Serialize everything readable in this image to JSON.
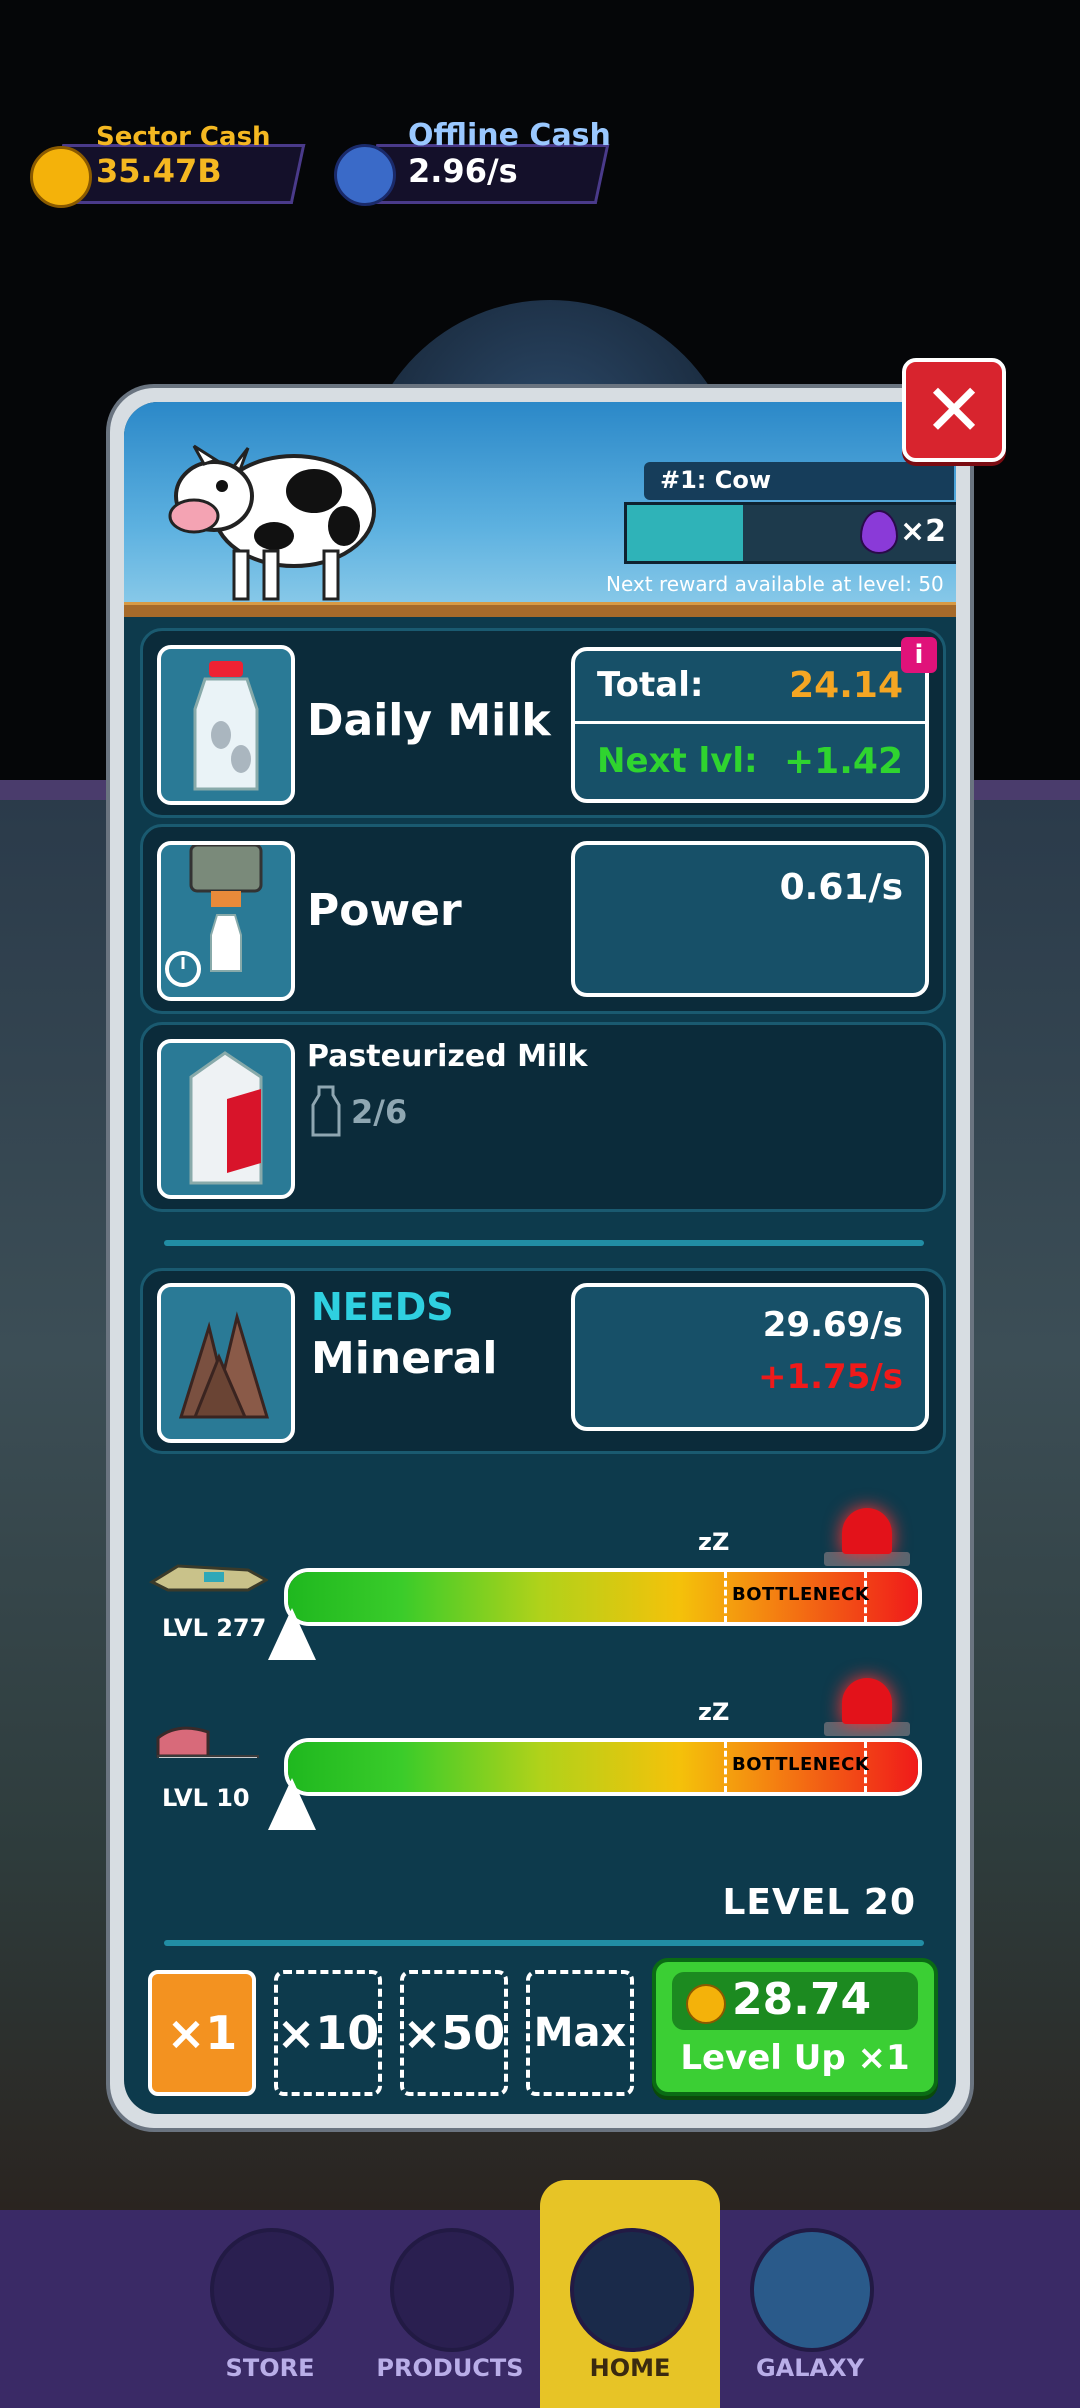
{
  "top_bar": {
    "sector_cash_label": "Sector Cash",
    "sector_cash_value": "35.47B",
    "offline_cash_label": "Offline Cash",
    "offline_cash_value": "2.96/s"
  },
  "modal": {
    "close_label": "✕",
    "reward": {
      "title": "#1: Cow",
      "gem_multiplier": "×2",
      "note": "Next reward available at level: 50",
      "progress_fraction": 0.35
    },
    "daily_milk": {
      "title": "Daily Milk",
      "info_badge": "i",
      "total_label": "Total:",
      "total_value": "24.14",
      "next_label": "Next lvl:",
      "next_value": "+1.42"
    },
    "power": {
      "title": "Power",
      "value": "0.61/s"
    },
    "pasteurized": {
      "title": "Pasteurized Milk",
      "count": "2/6"
    },
    "needs": {
      "needs_label": "NEEDS",
      "resource": "Mineral",
      "rate": "29.69/s",
      "delta": "+1.75/s"
    },
    "bottlenecks": [
      {
        "level_text": "LVL 277",
        "label": "BOTTLENECK",
        "pointer_fraction": 0.0
      },
      {
        "level_text": "LVL 10",
        "label": "BOTTLENECK",
        "pointer_fraction": 0.0
      }
    ],
    "level_text": "LEVEL 20",
    "multipliers": [
      "×1",
      "×10",
      "×50",
      "Max"
    ],
    "level_up": {
      "price": "28.74",
      "label": "Level Up ×1"
    }
  },
  "nav": {
    "items": [
      "STORE",
      "PRODUCTS",
      "HOME",
      "GALAXY"
    ],
    "active": "HOME"
  },
  "colors": {
    "accent_orange": "#f39220",
    "accent_green": "#3bcf34",
    "total_orange": "#f5a623",
    "next_green": "#2fd42f",
    "delta_red": "#f01a1a",
    "needs_cyan": "#2fd0e0"
  }
}
